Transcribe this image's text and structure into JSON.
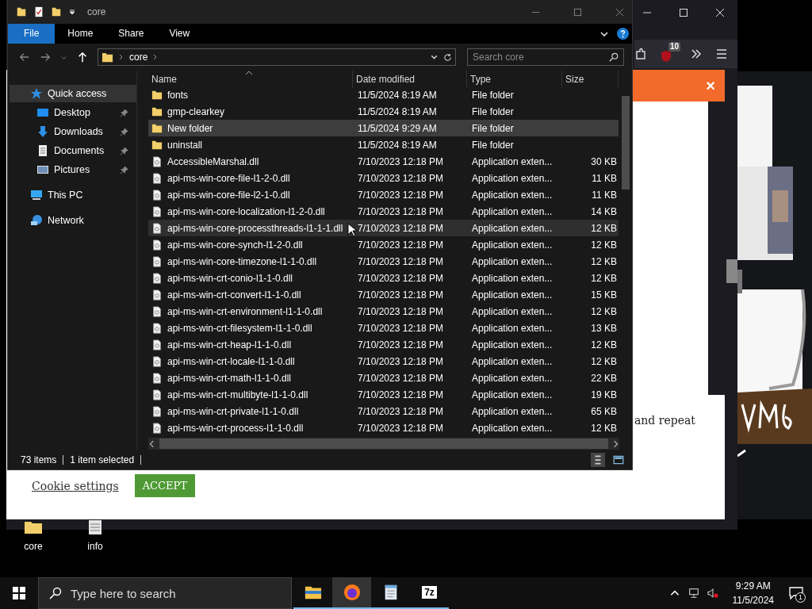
{
  "explorer": {
    "title": "core",
    "ribbon_tabs": [
      {
        "label": "File",
        "selected": true
      },
      {
        "label": "Home",
        "selected": false
      },
      {
        "label": "Share",
        "selected": false
      },
      {
        "label": "View",
        "selected": false
      }
    ],
    "address": {
      "path": "core"
    },
    "search": {
      "placeholder": "Search core"
    },
    "nav": [
      {
        "label": "Quick access",
        "kind": "quick",
        "selected": true,
        "pinned": false,
        "children": [
          {
            "label": "Desktop",
            "kind": "desktop",
            "selected": false,
            "pinned": true
          },
          {
            "label": "Downloads",
            "kind": "downloads",
            "selected": false,
            "pinned": true
          },
          {
            "label": "Documents",
            "kind": "documents",
            "selected": false,
            "pinned": true
          },
          {
            "label": "Pictures",
            "kind": "pictures",
            "selected": false,
            "pinned": true
          }
        ]
      },
      {
        "label": "This PC",
        "kind": "pc",
        "selected": false,
        "pinned": false
      },
      {
        "label": "Network",
        "kind": "network",
        "selected": false,
        "pinned": false
      }
    ],
    "columns": [
      "Name",
      "Date modified",
      "Type",
      "Size"
    ],
    "files": [
      {
        "name": "fonts",
        "kind": "folder",
        "date": "11/5/2024 8:19 AM",
        "type": "File folder",
        "selected": false,
        "hovered": false
      },
      {
        "name": "gmp-clearkey",
        "kind": "folder",
        "date": "11/5/2024 8:19 AM",
        "type": "File folder",
        "selected": false,
        "hovered": false
      },
      {
        "name": "New folder",
        "kind": "folder",
        "date": "11/5/2024 9:29 AM",
        "type": "File folder",
        "selected": true,
        "hovered": false
      },
      {
        "name": "uninstall",
        "kind": "folder",
        "date": "11/5/2024 8:19 AM",
        "type": "File folder",
        "selected": false,
        "hovered": false
      },
      {
        "name": "AccessibleMarshal.dll",
        "kind": "dll",
        "date": "7/10/2023 12:18 PM",
        "type": "Application exten...",
        "size": "30 KB",
        "selected": false,
        "hovered": false
      },
      {
        "name": "api-ms-win-core-file-l1-2-0.dll",
        "kind": "dll",
        "date": "7/10/2023 12:18 PM",
        "type": "Application exten...",
        "size": "11 KB",
        "selected": false,
        "hovered": false
      },
      {
        "name": "api-ms-win-core-file-l2-1-0.dll",
        "kind": "dll",
        "date": "7/10/2023 12:18 PM",
        "type": "Application exten...",
        "size": "11 KB",
        "selected": false,
        "hovered": false
      },
      {
        "name": "api-ms-win-core-localization-l1-2-0.dll",
        "kind": "dll",
        "date": "7/10/2023 12:18 PM",
        "type": "Application exten...",
        "size": "14 KB",
        "selected": false,
        "hovered": false
      },
      {
        "name": "api-ms-win-core-processthreads-l1-1-1.dll",
        "kind": "dll",
        "date": "7/10/2023 12:18 PM",
        "type": "Application exten...",
        "size": "12 KB",
        "selected": false,
        "hovered": true
      },
      {
        "name": "api-ms-win-core-synch-l1-2-0.dll",
        "kind": "dll",
        "date": "7/10/2023 12:18 PM",
        "type": "Application exten...",
        "size": "12 KB",
        "selected": false,
        "hovered": false
      },
      {
        "name": "api-ms-win-core-timezone-l1-1-0.dll",
        "kind": "dll",
        "date": "7/10/2023 12:18 PM",
        "type": "Application exten...",
        "size": "12 KB",
        "selected": false,
        "hovered": false
      },
      {
        "name": "api-ms-win-crt-conio-l1-1-0.dll",
        "kind": "dll",
        "date": "7/10/2023 12:18 PM",
        "type": "Application exten...",
        "size": "12 KB",
        "selected": false,
        "hovered": false
      },
      {
        "name": "api-ms-win-crt-convert-l1-1-0.dll",
        "kind": "dll",
        "date": "7/10/2023 12:18 PM",
        "type": "Application exten...",
        "size": "15 KB",
        "selected": false,
        "hovered": false
      },
      {
        "name": "api-ms-win-crt-environment-l1-1-0.dll",
        "kind": "dll",
        "date": "7/10/2023 12:18 PM",
        "type": "Application exten...",
        "size": "12 KB",
        "selected": false,
        "hovered": false
      },
      {
        "name": "api-ms-win-crt-filesystem-l1-1-0.dll",
        "kind": "dll",
        "date": "7/10/2023 12:18 PM",
        "type": "Application exten...",
        "size": "13 KB",
        "selected": false,
        "hovered": false
      },
      {
        "name": "api-ms-win-crt-heap-l1-1-0.dll",
        "kind": "dll",
        "date": "7/10/2023 12:18 PM",
        "type": "Application exten...",
        "size": "12 KB",
        "selected": false,
        "hovered": false
      },
      {
        "name": "api-ms-win-crt-locale-l1-1-0.dll",
        "kind": "dll",
        "date": "7/10/2023 12:18 PM",
        "type": "Application exten...",
        "size": "12 KB",
        "selected": false,
        "hovered": false
      },
      {
        "name": "api-ms-win-crt-math-l1-1-0.dll",
        "kind": "dll",
        "date": "7/10/2023 12:18 PM",
        "type": "Application exten...",
        "size": "22 KB",
        "selected": false,
        "hovered": false
      },
      {
        "name": "api-ms-win-crt-multibyte-l1-1-0.dll",
        "kind": "dll",
        "date": "7/10/2023 12:18 PM",
        "type": "Application exten...",
        "size": "19 KB",
        "selected": false,
        "hovered": false
      },
      {
        "name": "api-ms-win-crt-private-l1-1-0.dll",
        "kind": "dll",
        "date": "7/10/2023 12:18 PM",
        "type": "Application exten...",
        "size": "65 KB",
        "selected": false,
        "hovered": false
      },
      {
        "name": "api-ms-win-crt-process-l1-1-0.dll",
        "kind": "dll",
        "date": "7/10/2023 12:18 PM",
        "type": "Application exten...",
        "size": "12 KB",
        "selected": false,
        "hovered": false
      }
    ],
    "status": {
      "count": "73 items",
      "selection": "1 item selected"
    }
  },
  "browser": {
    "extension_badge": "10",
    "banner_close": "×",
    "page_text": "and repeat",
    "cookie_link": "Cookie settings",
    "accept_button": "ACCEPT"
  },
  "desktop_icons": [
    {
      "label": "core",
      "kind": "folder"
    },
    {
      "label": "info",
      "kind": "notepad"
    }
  ],
  "taskbar": {
    "search": {
      "placeholder": "Type here to search"
    },
    "apps": [
      {
        "kind": "explorer",
        "selected": false
      },
      {
        "kind": "firefox",
        "selected": true
      },
      {
        "kind": "notepad",
        "selected": false
      },
      {
        "kind": "archiver",
        "label": "7z",
        "selected": false
      }
    ],
    "time": "9:29 AM",
    "date": "11/5/2024",
    "notification_count": "1"
  }
}
